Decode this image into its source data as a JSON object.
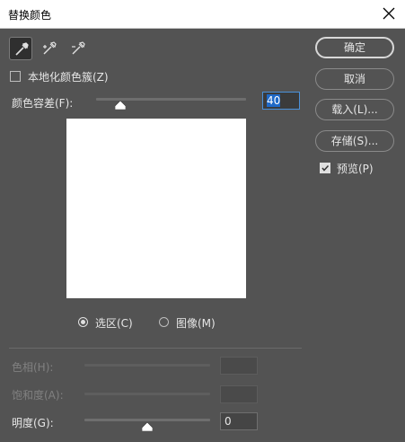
{
  "window": {
    "title": "替换颜色"
  },
  "tools": [
    {
      "icon": "eyedropper-icon"
    },
    {
      "icon": "eyedropper-plus-icon"
    },
    {
      "icon": "eyedropper-minus-icon"
    }
  ],
  "localized_clusters": {
    "label": "本地化颜色簇(Z)",
    "checked": false
  },
  "fuzziness": {
    "label": "颜色容差(F):",
    "value": "40",
    "slider_fraction": 0.16
  },
  "view_mode": {
    "options": [
      {
        "label": "选区(C)",
        "selected": true
      },
      {
        "label": "图像(M)",
        "selected": false
      }
    ]
  },
  "replacement": {
    "hue": {
      "label": "色相(H):",
      "value": "",
      "disabled": true
    },
    "saturation": {
      "label": "饱和度(A):",
      "value": "",
      "disabled": true
    },
    "lightness": {
      "label": "明度(G):",
      "value": "0",
      "slider_fraction": 0.5
    }
  },
  "buttons": {
    "ok": "确定",
    "cancel": "取消",
    "load": "载入(L)...",
    "save": "存储(S)..."
  },
  "preview": {
    "label": "预览(P)",
    "checked": true
  },
  "colors": {
    "dialog_bg": "#535353",
    "focus": "#4a90d9",
    "selection": "#1f69c7"
  }
}
